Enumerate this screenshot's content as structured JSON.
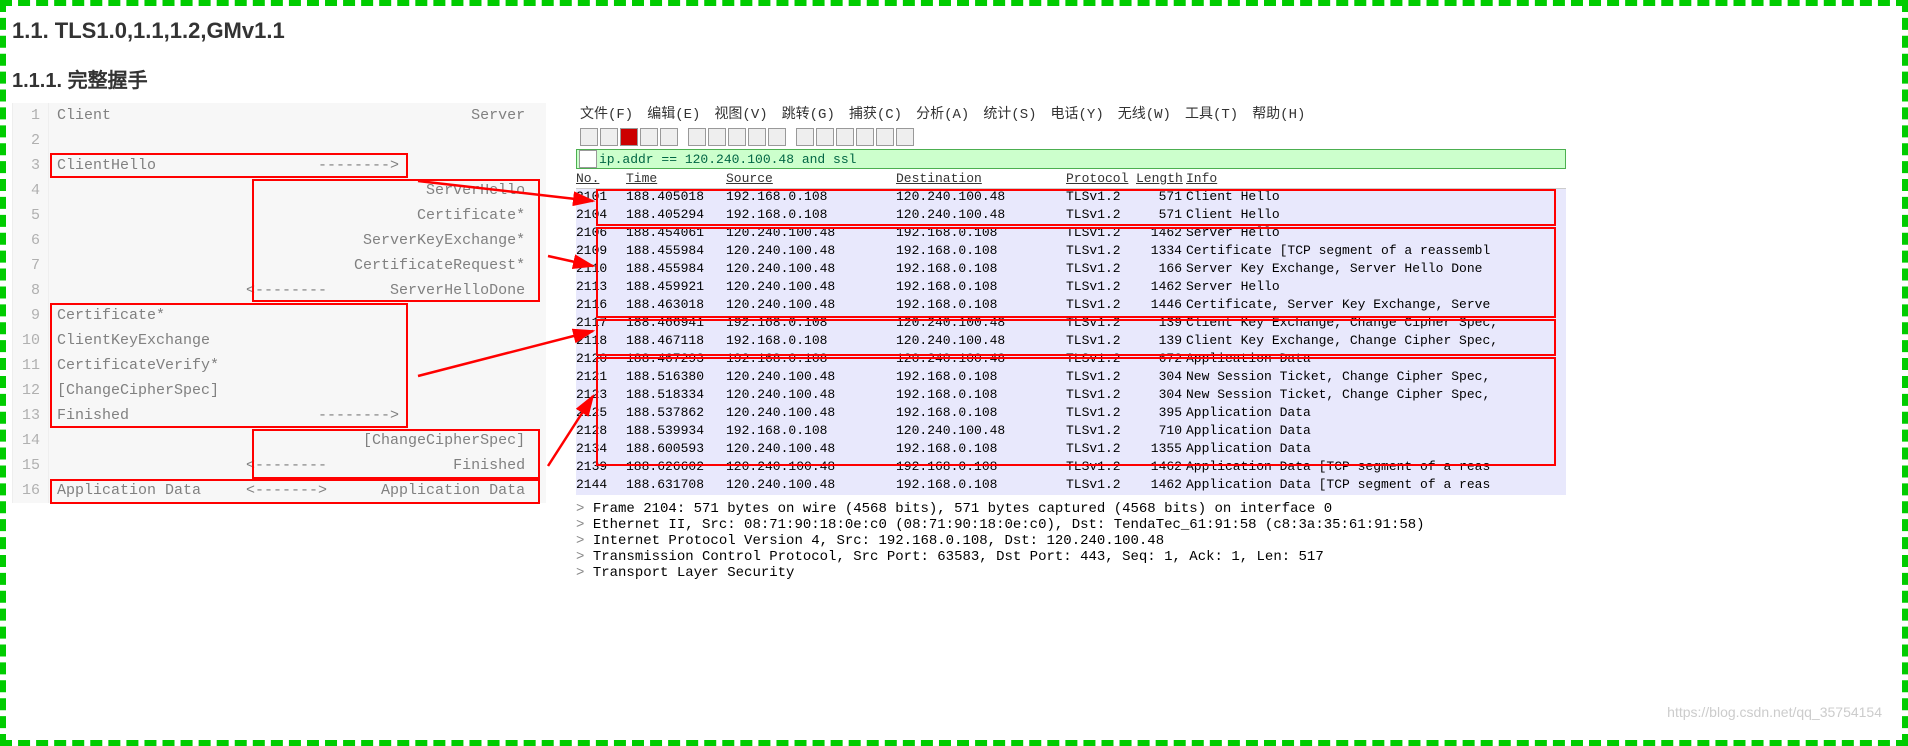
{
  "heading": "1.1. TLS1.0,1.1,1.2,GMv1.1",
  "subheading": "1.1.1. 完整握手",
  "code": {
    "l1": "Client                                        Server",
    "l2": "",
    "l3": "ClientHello                  -------->",
    "l4": "                                         ServerHello",
    "l5": "                                        Certificate*",
    "l6": "                                  ServerKeyExchange*",
    "l7": "                                 CertificateRequest*",
    "l8": "                     <--------       ServerHelloDone",
    "l9": "Certificate*",
    "l10": "ClientKeyExchange",
    "l11": "CertificateVerify*",
    "l12": "[ChangeCipherSpec]",
    "l13": "Finished                     -------->",
    "l14": "                                  [ChangeCipherSpec]",
    "l15": "                     <--------              Finished",
    "l16": "Application Data     <------->      Application Data"
  },
  "menu": {
    "m1": "文件(F)",
    "m2": "编辑(E)",
    "m3": "视图(V)",
    "m4": "跳转(G)",
    "m5": "捕获(C)",
    "m6": "分析(A)",
    "m7": "统计(S)",
    "m8": "电话(Y)",
    "m9": "无线(W)",
    "m10": "工具(T)",
    "m11": "帮助(H)"
  },
  "filter": "ip.addr == 120.240.100.48 and ssl",
  "headers": {
    "no": "No.",
    "time": "Time",
    "src": "Source",
    "dst": "Destination",
    "proto": "Protocol",
    "len": "Length",
    "info": "Info"
  },
  "packets": [
    {
      "no": "2101",
      "time": "188.405018",
      "src": "192.168.0.108",
      "dst": "120.240.100.48",
      "proto": "TLSv1.2",
      "len": "571",
      "info": "Client Hello"
    },
    {
      "no": "2104",
      "time": "188.405294",
      "src": "192.168.0.108",
      "dst": "120.240.100.48",
      "proto": "TLSv1.2",
      "len": "571",
      "info": "Client Hello"
    },
    {
      "no": "2106",
      "time": "188.454061",
      "src": "120.240.100.48",
      "dst": "192.168.0.108",
      "proto": "TLSv1.2",
      "len": "1462",
      "info": "Server Hello"
    },
    {
      "no": "2109",
      "time": "188.455984",
      "src": "120.240.100.48",
      "dst": "192.168.0.108",
      "proto": "TLSv1.2",
      "len": "1334",
      "info": "Certificate [TCP segment of a reassembl"
    },
    {
      "no": "2110",
      "time": "188.455984",
      "src": "120.240.100.48",
      "dst": "192.168.0.108",
      "proto": "TLSv1.2",
      "len": "166",
      "info": "Server Key Exchange, Server Hello Done"
    },
    {
      "no": "2113",
      "time": "188.459921",
      "src": "120.240.100.48",
      "dst": "192.168.0.108",
      "proto": "TLSv1.2",
      "len": "1462",
      "info": "Server Hello"
    },
    {
      "no": "2116",
      "time": "188.463018",
      "src": "120.240.100.48",
      "dst": "192.168.0.108",
      "proto": "TLSv1.2",
      "len": "1446",
      "info": "Certificate, Server Key Exchange, Serve"
    },
    {
      "no": "2117",
      "time": "188.466941",
      "src": "192.168.0.108",
      "dst": "120.240.100.48",
      "proto": "TLSv1.2",
      "len": "139",
      "info": "Client Key Exchange, Change Cipher Spec,"
    },
    {
      "no": "2118",
      "time": "188.467118",
      "src": "192.168.0.108",
      "dst": "120.240.100.48",
      "proto": "TLSv1.2",
      "len": "139",
      "info": "Client Key Exchange, Change Cipher Spec,"
    },
    {
      "no": "2120",
      "time": "188.467293",
      "src": "192.168.0.108",
      "dst": "120.240.100.48",
      "proto": "TLSv1.2",
      "len": "672",
      "info": "Application Data"
    },
    {
      "no": "2121",
      "time": "188.516380",
      "src": "120.240.100.48",
      "dst": "192.168.0.108",
      "proto": "TLSv1.2",
      "len": "304",
      "info": "New Session Ticket, Change Cipher Spec,"
    },
    {
      "no": "2123",
      "time": "188.518334",
      "src": "120.240.100.48",
      "dst": "192.168.0.108",
      "proto": "TLSv1.2",
      "len": "304",
      "info": "New Session Ticket, Change Cipher Spec,"
    },
    {
      "no": "2125",
      "time": "188.537862",
      "src": "120.240.100.48",
      "dst": "192.168.0.108",
      "proto": "TLSv1.2",
      "len": "395",
      "info": "Application Data"
    },
    {
      "no": "2128",
      "time": "188.539934",
      "src": "192.168.0.108",
      "dst": "120.240.100.48",
      "proto": "TLSv1.2",
      "len": "710",
      "info": "Application Data"
    },
    {
      "no": "2134",
      "time": "188.600593",
      "src": "120.240.100.48",
      "dst": "192.168.0.108",
      "proto": "TLSv1.2",
      "len": "1355",
      "info": "Application Data"
    },
    {
      "no": "2139",
      "time": "188.626602",
      "src": "120.240.100.48",
      "dst": "192.168.0.108",
      "proto": "TLSv1.2",
      "len": "1462",
      "info": "Application Data [TCP segment of a reas"
    },
    {
      "no": "2144",
      "time": "188.631708",
      "src": "120.240.100.48",
      "dst": "192.168.0.108",
      "proto": "TLSv1.2",
      "len": "1462",
      "info": "Application Data [TCP segment of a reas"
    }
  ],
  "details": {
    "d1": "Frame 2104: 571 bytes on wire (4568 bits), 571 bytes captured (4568 bits) on interface 0",
    "d2": "Ethernet II, Src: 08:71:90:18:0e:c0 (08:71:90:18:0e:c0), Dst: TendaTec_61:91:58 (c8:3a:35:61:91:58)",
    "d3": "Internet Protocol Version 4, Src: 192.168.0.108, Dst: 120.240.100.48",
    "d4": "Transmission Control Protocol, Src Port: 63583, Dst Port: 443, Seq: 1, Ack: 1, Len: 517",
    "d5": "Transport Layer Security"
  },
  "watermark": "https://blog.csdn.net/qq_35754154"
}
